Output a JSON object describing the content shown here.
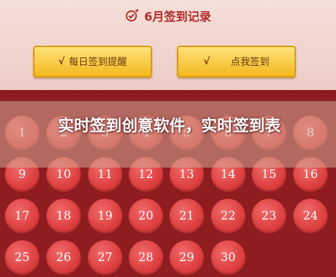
{
  "header": {
    "title": "6月签到记录",
    "icon": "pen-check-icon"
  },
  "buttons": {
    "remind": {
      "check": "√",
      "label": "每日签到提醒"
    },
    "checkin": {
      "check": "√",
      "label": "点我签到"
    }
  },
  "calendar": {
    "days": [
      "1",
      "2",
      "3",
      "4",
      "5",
      "6",
      "7",
      "8",
      "9",
      "10",
      "11",
      "12",
      "13",
      "14",
      "15",
      "16",
      "17",
      "18",
      "19",
      "20",
      "21",
      "22",
      "23",
      "24",
      "25",
      "26",
      "27",
      "28",
      "29",
      "30"
    ]
  },
  "overlay": {
    "caption": "实时签到创意软件，实时签到表"
  },
  "colors": {
    "background": "#8f1c1f",
    "day_circle": "#dd3e3e",
    "button": "#f3b81e",
    "title": "#b22c2c"
  }
}
